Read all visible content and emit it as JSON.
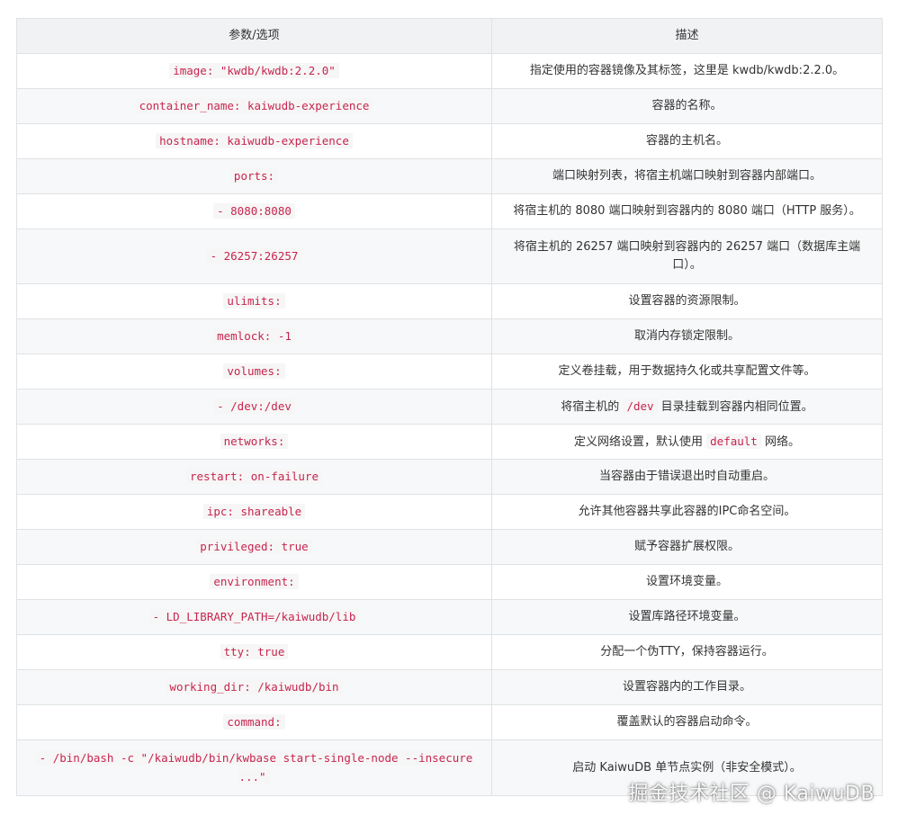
{
  "table": {
    "headers": [
      "参数/选项",
      "描述"
    ],
    "rows": [
      {
        "param": "image: \"kwdb/kwdb:2.2.0\"",
        "desc": "指定使用的容器镜像及其标签，这里是 kwdb/kwdb:2.2.0。"
      },
      {
        "param": "container_name: kaiwudb-experience",
        "desc": "容器的名称。"
      },
      {
        "param": "hostname: kaiwudb-experience",
        "desc": "容器的主机名。"
      },
      {
        "param": "ports:",
        "desc": "端口映射列表，将宿主机端口映射到容器内部端口。"
      },
      {
        "param": "- 8080:8080",
        "desc": "将宿主机的 8080 端口映射到容器内的 8080 端口（HTTP 服务）。"
      },
      {
        "param": "- 26257:26257",
        "desc": "将宿主机的 26257 端口映射到容器内的 26257 端口（数据库主端口）。"
      },
      {
        "param": "ulimits:",
        "desc": "设置容器的资源限制。"
      },
      {
        "param": "memlock: -1",
        "desc": "取消内存锁定限制。"
      },
      {
        "param": "volumes:",
        "desc": "定义卷挂载，用于数据持久化或共享配置文件等。"
      },
      {
        "param": "- /dev:/dev",
        "desc_pre": "将宿主机的 ",
        "desc_code": "/dev",
        "desc_post": " 目录挂载到容器内相同位置。"
      },
      {
        "param": "networks:",
        "desc_pre": "定义网络设置，默认使用 ",
        "desc_code": "default",
        "desc_post": " 网络。"
      },
      {
        "param": "restart: on-failure",
        "desc": "当容器由于错误退出时自动重启。"
      },
      {
        "param": "ipc: shareable",
        "desc": "允许其他容器共享此容器的IPC命名空间。"
      },
      {
        "param": "privileged: true",
        "desc": "赋予容器扩展权限。"
      },
      {
        "param": "environment:",
        "desc": "设置环境变量。"
      },
      {
        "param": "- LD_LIBRARY_PATH=/kaiwudb/lib",
        "desc": "设置库路径环境变量。"
      },
      {
        "param": "tty: true",
        "desc": "分配一个伪TTY，保持容器运行。"
      },
      {
        "param": "working_dir: /kaiwudb/bin",
        "desc": "设置容器内的工作目录。"
      },
      {
        "param": "command:",
        "desc": "覆盖默认的容器启动命令。"
      },
      {
        "param": "- /bin/bash -c \"/kaiwudb/bin/kwbase start-single-node --insecure ...\"",
        "desc": "启动 KaiwuDB 单节点实例（非安全模式）。"
      }
    ]
  },
  "watermark": "掘金技术社区 @ KaiwuDB"
}
